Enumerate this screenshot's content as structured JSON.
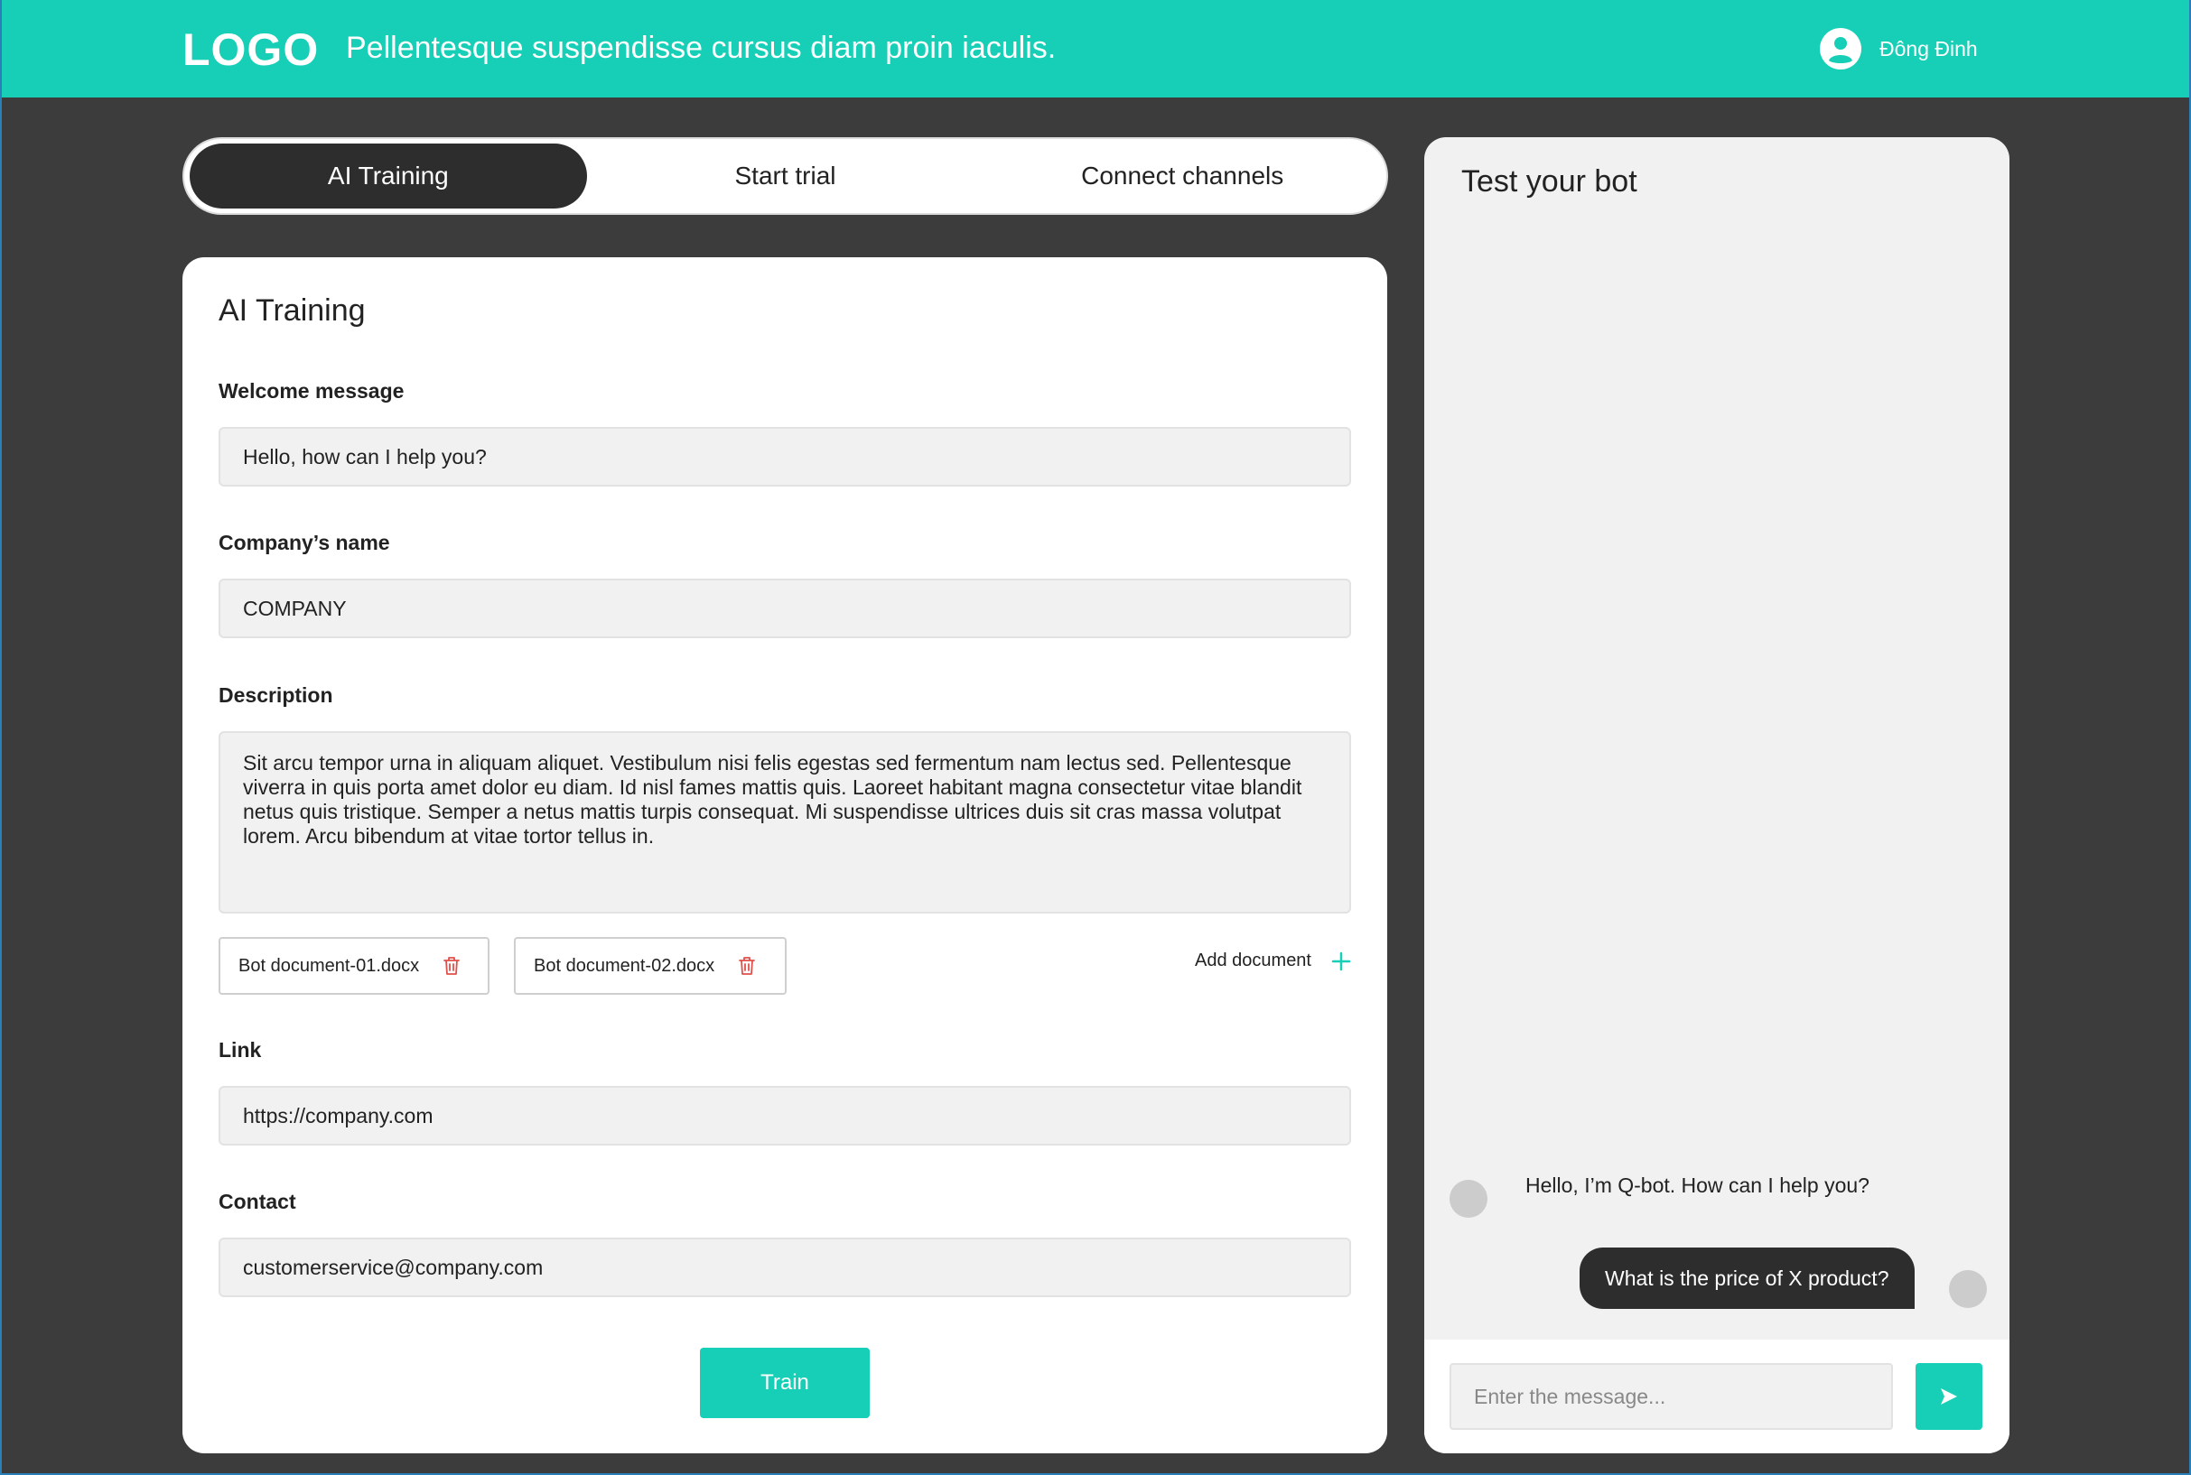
{
  "header": {
    "logo": "LOGO",
    "tagline": "Pellentesque suspendisse cursus diam proin iaculis.",
    "user_name": "Đông Đinh"
  },
  "tabs": [
    {
      "label": "AI Training",
      "active": true
    },
    {
      "label": "Start trial",
      "active": false
    },
    {
      "label": "Connect channels",
      "active": false
    }
  ],
  "form": {
    "title": "AI Training",
    "welcome": {
      "label": "Welcome message",
      "value": "Hello, how can I help you?"
    },
    "company": {
      "label": "Company’s name",
      "value": "COMPANY"
    },
    "description": {
      "label": "Description",
      "value": "Sit arcu tempor urna in aliquam aliquet. Vestibulum nisi felis egestas sed fermentum nam lectus sed. Pellentesque viverra in quis porta amet dolor eu diam. Id nisl fames mattis quis. Laoreet habitant magna consectetur vitae blandit netus quis tristique. Semper a netus mattis turpis consequat. Mi suspendisse ultrices duis sit cras massa volutpat lorem. Arcu bibendum at vitae tortor tellus in."
    },
    "documents": [
      "Bot document-01.docx",
      "Bot document-02.docx"
    ],
    "add_document": "Add document",
    "link": {
      "label": "Link",
      "value": "https://company.com"
    },
    "contact": {
      "label": "Contact",
      "value": "customerservice@company.com"
    },
    "train_label": "Train"
  },
  "chat": {
    "title": "Test your bot",
    "bot_message": "Hello, I’m Q-bot. How can I help you?",
    "user_message": "What is the price of X product?",
    "input_placeholder": "Enter the message..."
  },
  "colors": {
    "accent": "#17cfb7",
    "dark": "#2d2d2d",
    "background": "#3c3c3c",
    "trash": "#e0504b"
  },
  "icons": {
    "user": "user-circle-icon",
    "trash": "trash-icon",
    "add": "plus-icon",
    "send": "send-icon"
  }
}
